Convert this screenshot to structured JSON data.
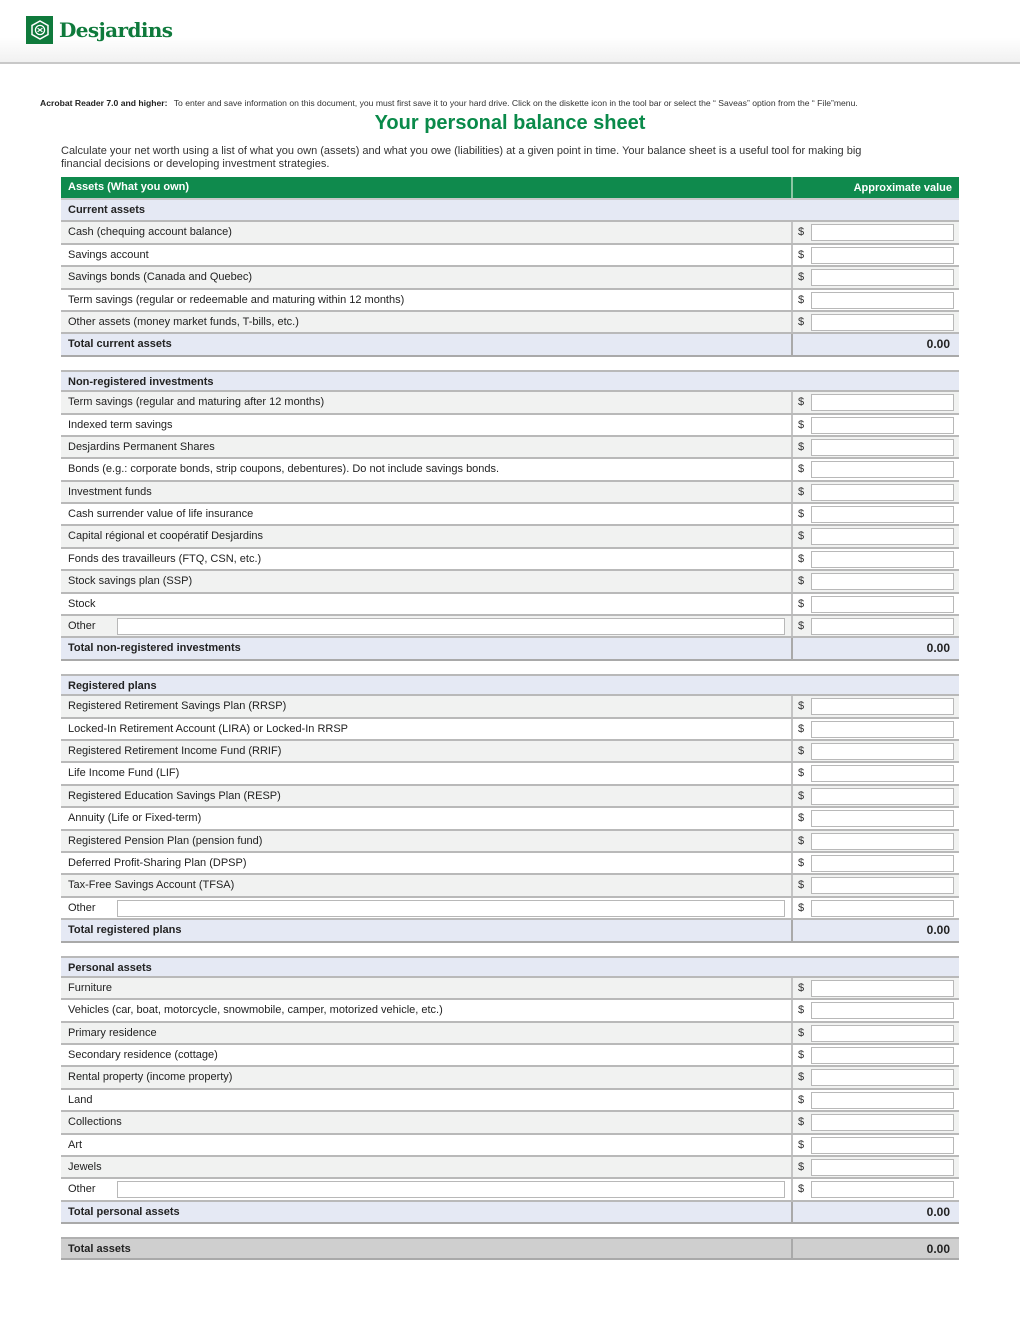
{
  "brand": {
    "name": "Desjardins",
    "color": "#0f7a3c",
    "icon": "desjardins-hexagon-logo-icon"
  },
  "notice": {
    "label": "Acrobat Reader 7.0 and higher:",
    "text": "To enter and save information on this document, you must first save it to your hard drive. Click on the diskette icon in the tool bar or select the “ Saveas” option from the “ File”menu."
  },
  "title": "Your personal balance sheet",
  "intro": "Calculate your net worth using a list of what you own (assets) and what you owe (liabilities) at a given point in time. Your balance sheet is a useful tool for making big financial decisions or developing investment strategies.",
  "table": {
    "header": {
      "label": "Assets (What you own)",
      "value": "Approximate value"
    },
    "currency_symbol": "$",
    "sections": [
      {
        "title": "Current assets",
        "items": [
          "Cash (chequing account balance)",
          "Savings account",
          "Savings bonds (Canada and Quebec)",
          "Term savings (regular or redeemable and maturing within 12 months)",
          "Other assets (money market funds, T-bills, etc.)"
        ],
        "has_other": false,
        "total_label": "Total current assets",
        "total_value": "0.00"
      },
      {
        "title": "Non-registered investments",
        "items": [
          "Term savings (regular and maturing after 12 months)",
          "Indexed term savings",
          "Desjardins Permanent Shares",
          "Bonds (e.g.: corporate bonds, strip coupons, debentures). Do not include savings bonds.",
          "Investment funds",
          "Cash surrender value of life insurance",
          "Capital régional et coopératif Desjardins",
          "Fonds des travailleurs (FTQ, CSN, etc.)",
          "Stock savings plan (SSP)",
          "Stock",
          "Other"
        ],
        "has_other": true,
        "total_label": "Total non-registered investments",
        "total_value": "0.00"
      },
      {
        "title": "Registered plans",
        "items": [
          "Registered Retirement Savings Plan (RRSP)",
          "Locked-In Retirement Account (LIRA) or Locked-In RRSP",
          "Registered Retirement Income Fund (RRIF)",
          "Life Income Fund (LIF)",
          "Registered Education Savings Plan (RESP)",
          "Annuity (Life or Fixed-term)",
          "Registered Pension Plan (pension fund)",
          "Deferred Profit-Sharing Plan (DPSP)",
          "Tax-Free Savings Account (TFSA)",
          "Other"
        ],
        "has_other": true,
        "total_label": "Total registered plans",
        "total_value": "0.00"
      },
      {
        "title": "Personal assets",
        "items": [
          "Furniture",
          "Vehicles (car, boat, motorcycle, snowmobile, camper, motorized vehicle, etc.)",
          "Primary residence",
          "Secondary residence (cottage)",
          "Rental property (income property)",
          "Land",
          "Collections",
          "Art",
          "Jewels",
          "Other"
        ],
        "has_other": true,
        "total_label": "Total personal assets",
        "total_value": "0.00"
      }
    ],
    "grand_total": {
      "label": "Total assets",
      "value": "0.00"
    }
  }
}
